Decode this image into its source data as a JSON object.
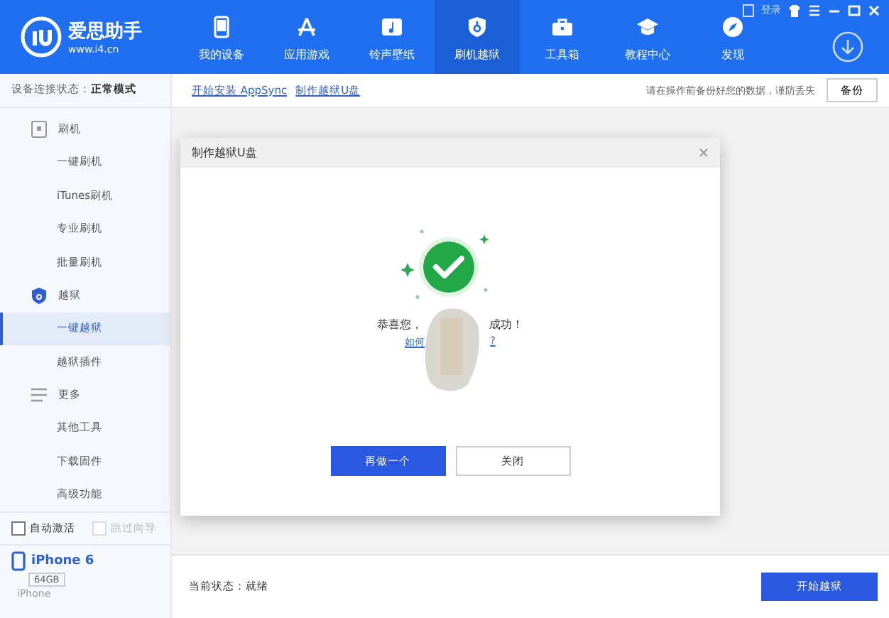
{
  "app": {
    "name": "爱思助手",
    "url": "www.i4.cn"
  },
  "nav": [
    {
      "label": "我的设备",
      "selected": false
    },
    {
      "label": "应用游戏",
      "selected": false
    },
    {
      "label": "铃声壁纸",
      "selected": false
    },
    {
      "label": "刷机越狱",
      "selected": true
    },
    {
      "label": "工具箱",
      "selected": false
    },
    {
      "label": "教程中心",
      "selected": false
    },
    {
      "label": "发现",
      "selected": false
    }
  ],
  "login": "登录",
  "connection": {
    "label": "设备连接状态：",
    "value": "正常模式"
  },
  "links": [
    "开始安装 AppSync",
    "制作越狱U盘"
  ],
  "backup_hint": "请在操作前备份好您的数据，谨防丢失",
  "backup_button": "备份",
  "sidebar": [
    {
      "label": "刷机",
      "children": [
        {
          "label": "一键刷机",
          "selected": false
        },
        {
          "label": "iTunes刷机",
          "selected": false
        },
        {
          "label": "专业刷机",
          "selected": false
        },
        {
          "label": "批量刷机",
          "selected": false
        }
      ]
    },
    {
      "label": "越狱",
      "children": [
        {
          "label": "一键越狱",
          "selected": true
        },
        {
          "label": "越狱插件",
          "selected": false
        }
      ]
    },
    {
      "label": "更多",
      "children": [
        {
          "label": "其他工具",
          "selected": false
        },
        {
          "label": "下载固件",
          "selected": false
        },
        {
          "label": "高级功能",
          "selected": false
        }
      ]
    }
  ],
  "options": [
    {
      "label": "自动激活",
      "checked": false,
      "disabled": false
    },
    {
      "label": "跳过向导",
      "checked": false,
      "disabled": true
    }
  ],
  "device": {
    "name": "iPhone 6",
    "capacity": "64GB",
    "model": "iPhone"
  },
  "dialog": {
    "title": "制作越狱U盘",
    "message_start": "恭喜您，",
    "message_end": "成功！",
    "link_start": "如何",
    "link_end": "?",
    "buttons": [
      {
        "label": "再做一个",
        "kind": "primary"
      },
      {
        "label": "关闭",
        "kind": "secondary"
      }
    ]
  },
  "status": {
    "label": "当前状态：",
    "value": "就绪"
  },
  "start_button": "开始越狱"
}
